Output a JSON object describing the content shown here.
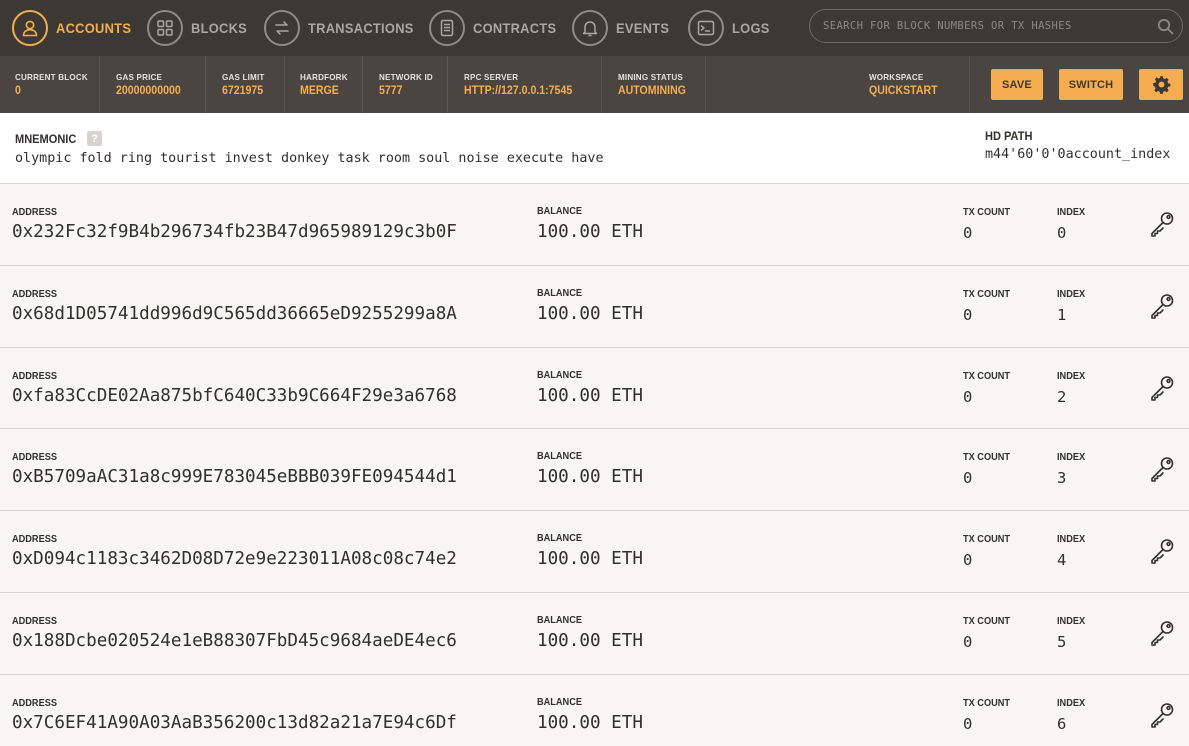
{
  "nav": {
    "items": [
      {
        "label": "ACCOUNTS",
        "icon": "user-icon"
      },
      {
        "label": "BLOCKS",
        "icon": "grid-icon"
      },
      {
        "label": "TRANSACTIONS",
        "icon": "swap-arrows-icon"
      },
      {
        "label": "CONTRACTS",
        "icon": "document-icon"
      },
      {
        "label": "EVENTS",
        "icon": "bell-icon"
      },
      {
        "label": "LOGS",
        "icon": "terminal-icon"
      }
    ],
    "search_placeholder": "SEARCH FOR BLOCK NUMBERS OR TX HASHES"
  },
  "status": {
    "current_block": {
      "label": "CURRENT BLOCK",
      "value": "0"
    },
    "gas_price": {
      "label": "GAS PRICE",
      "value": "20000000000"
    },
    "gas_limit": {
      "label": "GAS LIMIT",
      "value": "6721975"
    },
    "hardfork": {
      "label": "HARDFORK",
      "value": "MERGE"
    },
    "network_id": {
      "label": "NETWORK ID",
      "value": "5777"
    },
    "rpc_server": {
      "label": "RPC SERVER",
      "value": "HTTP://127.0.0.1:7545"
    },
    "mining_status": {
      "label": "MINING STATUS",
      "value": "AUTOMINING"
    },
    "workspace": {
      "label": "WORKSPACE",
      "value": "QUICKSTART"
    }
  },
  "buttons": {
    "save": "SAVE",
    "switch": "SWITCH"
  },
  "mnemonic": {
    "label": "MNEMONIC",
    "help": "?",
    "value": "olympic fold ring tourist invest donkey task room soul noise execute have"
  },
  "hd_path": {
    "label": "HD PATH",
    "value": "m44'60'0'0account_index"
  },
  "field_labels": {
    "address": "ADDRESS",
    "balance": "BALANCE",
    "tx_count": "TX COUNT",
    "index": "INDEX"
  },
  "accounts": [
    {
      "address": "0x232Fc32f9B4b296734fb23B47d965989129c3b0F",
      "balance": "100.00 ETH",
      "tx_count": "0",
      "index": "0"
    },
    {
      "address": "0x68d1D05741dd996d9C565dd36665eD9255299a8A",
      "balance": "100.00 ETH",
      "tx_count": "0",
      "index": "1"
    },
    {
      "address": "0xfa83CcDE02Aa875bfC640C33b9C664F29e3a6768",
      "balance": "100.00 ETH",
      "tx_count": "0",
      "index": "2"
    },
    {
      "address": "0xB5709aAC31a8c999E783045eBBB039FE094544d1",
      "balance": "100.00 ETH",
      "tx_count": "0",
      "index": "3"
    },
    {
      "address": "0xD094c1183c3462D08D72e9e223011A08c08c74e2",
      "balance": "100.00 ETH",
      "tx_count": "0",
      "index": "4"
    },
    {
      "address": "0x188Dcbe020524e1eB88307FbD45c9684aeDE4ec6",
      "balance": "100.00 ETH",
      "tx_count": "0",
      "index": "5"
    },
    {
      "address": "0x7C6EF41A90A03AaB356200c13d82a21a7E94c6Df",
      "balance": "100.00 ETH",
      "tx_count": "0",
      "index": "6"
    }
  ],
  "colors": {
    "accent": "#f6ad4f",
    "nav_bg": "#3c3935",
    "status_bg": "#4a4541",
    "row_bg": "#f7f6f2"
  }
}
